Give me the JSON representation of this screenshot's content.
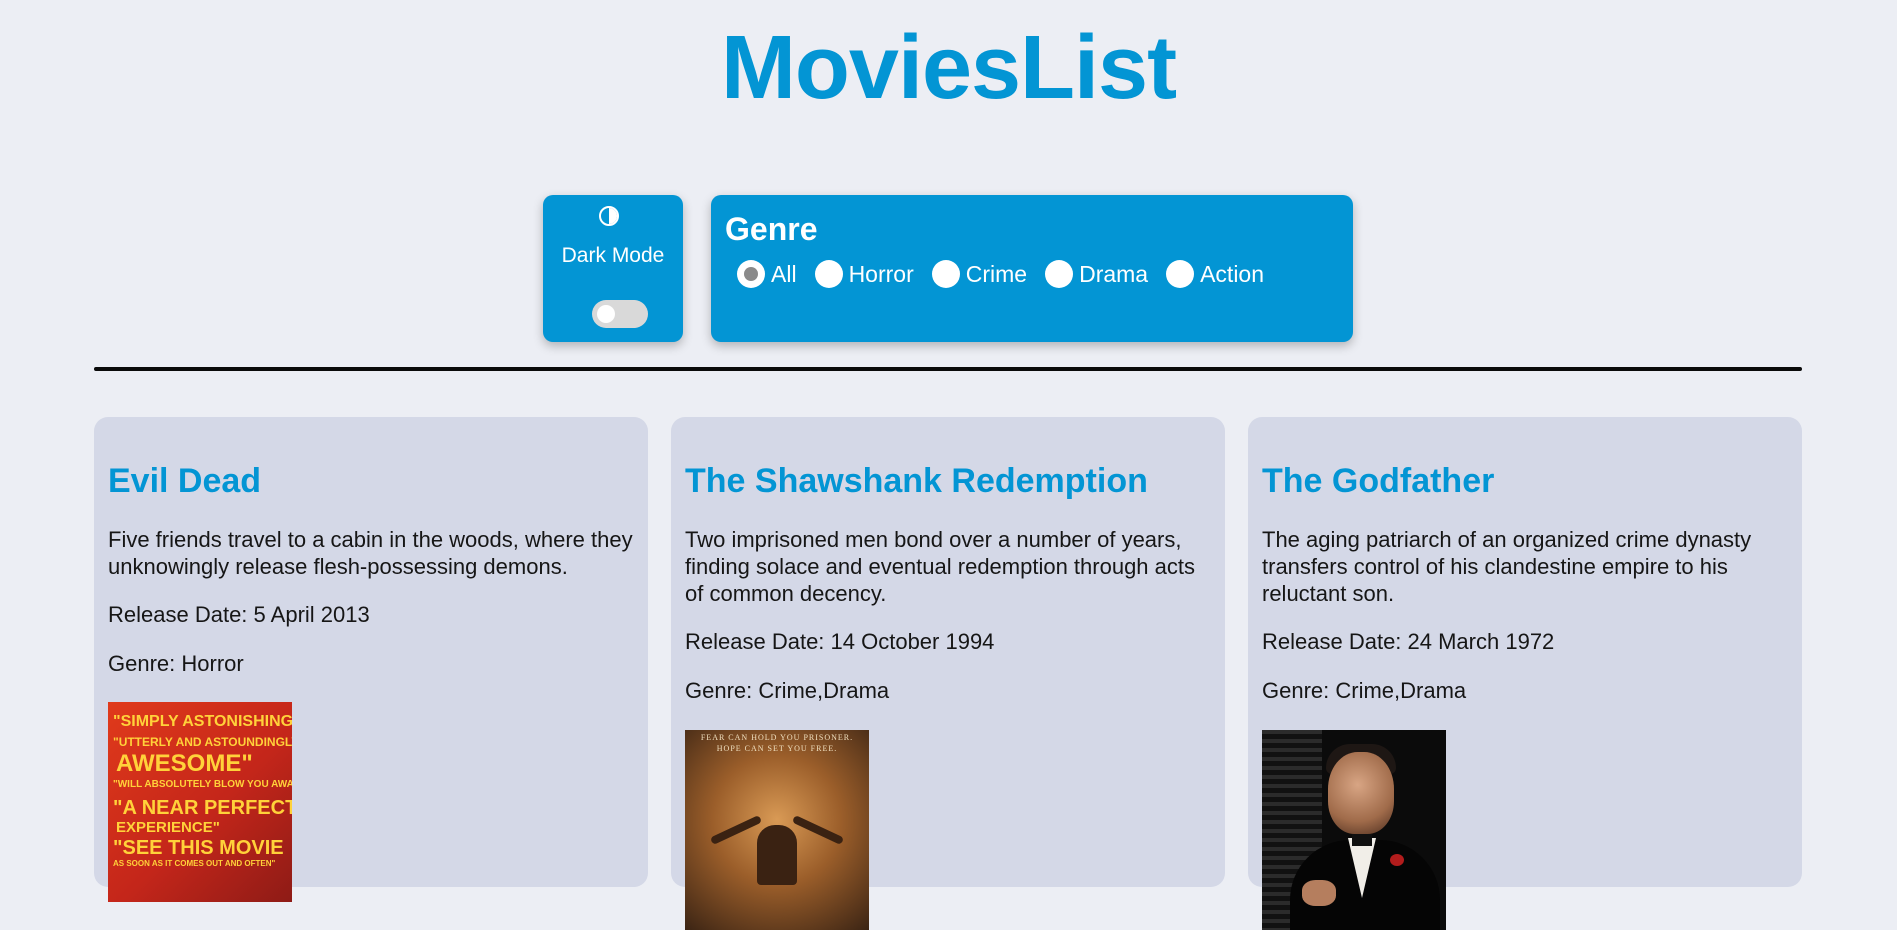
{
  "app": {
    "title": "MoviesList"
  },
  "dark_mode": {
    "label": "Dark Mode",
    "icon": "contrast-icon",
    "enabled": false
  },
  "genre_filter": {
    "title": "Genre",
    "options": [
      "All",
      "Horror",
      "Crime",
      "Drama",
      "Action"
    ],
    "selected": "All"
  },
  "movies": [
    {
      "title": "Evil Dead",
      "description": "Five friends travel to a cabin in the woods, where they unknowingly release flesh-possessing demons.",
      "release": "Release Date: 5 April 2013",
      "genre": "Genre: Horror",
      "poster_text": [
        "\"SIMPLY ASTONISHING\"",
        "\"UTTERLY AND ASTOUNDINGLY",
        "AWESOME\"",
        "\"WILL ABSOLUTELY BLOW YOU AWAY\"",
        "\"A NEAR PERFECT",
        "EXPERIENCE\"",
        "\"SEE THIS MOVIE",
        "AS SOON AS IT COMES OUT AND OFTEN\""
      ]
    },
    {
      "title": "The Shawshank Redemption",
      "description": "Two imprisoned men bond over a number of years, finding solace and eventual redemption through acts of common decency.",
      "release": "Release Date: 14 October 1994",
      "genre": "Genre: Crime,Drama",
      "poster_text": [
        "FEAR CAN HOLD YOU PRISONER.",
        "HOPE CAN SET YOU FREE."
      ]
    },
    {
      "title": "The Godfather",
      "description": "The aging patriarch of an organized crime dynasty transfers control of his clandestine empire to his reluctant son.",
      "release": "Release Date: 24 March 1972",
      "genre": "Genre: Crime,Drama",
      "poster_text": []
    }
  ],
  "colors": {
    "accent": "#0395d4",
    "background": "#eceef4",
    "card": "#d4d8e7",
    "text": "#161616"
  }
}
